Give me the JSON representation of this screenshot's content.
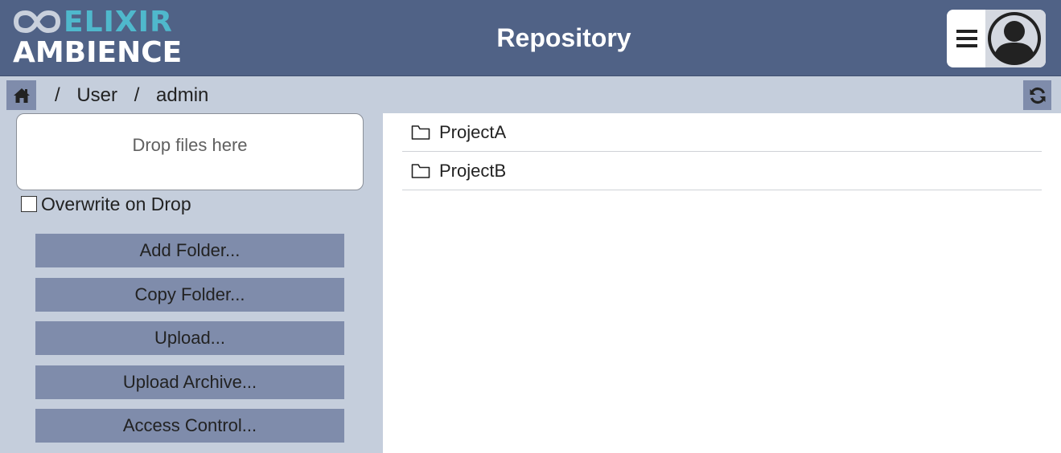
{
  "header": {
    "logo_top": "ELIXIR",
    "logo_bottom": "AMBIENCE",
    "title": "Repository",
    "brand_color": "#4fb8cc",
    "icons": {
      "menu": "hamburger-menu-icon",
      "user": "user-avatar-icon"
    }
  },
  "breadcrumb": {
    "home_icon": "home-icon",
    "separator": "/",
    "segments": [
      "User",
      "admin"
    ],
    "refresh_icon": "refresh-icon"
  },
  "sidebar": {
    "drop_text": "Drop files here",
    "overwrite_label": "Overwrite on Drop",
    "overwrite_checked": false,
    "buttons": [
      {
        "label": "Add Folder..."
      },
      {
        "label": "Copy Folder..."
      },
      {
        "label": "Upload..."
      },
      {
        "label": "Upload Archive..."
      },
      {
        "label": "Access Control..."
      }
    ]
  },
  "files": [
    {
      "name": "ProjectA",
      "icon": "folder-icon"
    },
    {
      "name": "ProjectB",
      "icon": "folder-icon"
    }
  ]
}
